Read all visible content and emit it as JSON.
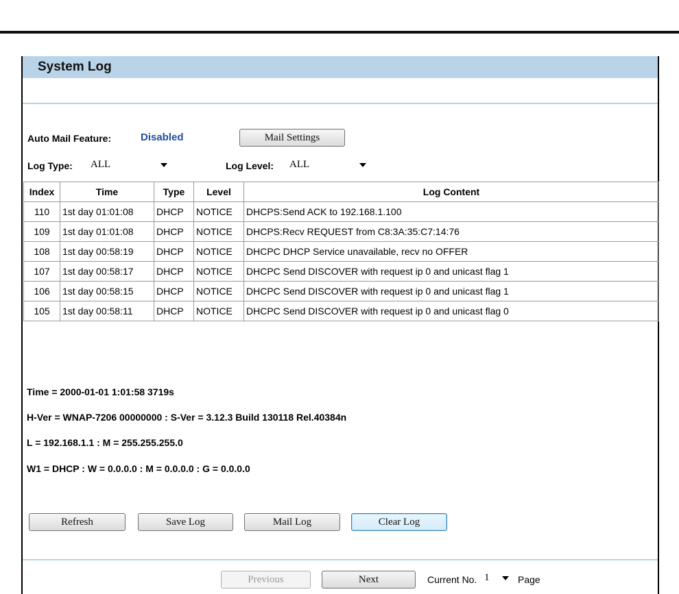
{
  "title": "System Log",
  "mail": {
    "label": "Auto Mail Feature:",
    "status": "Disabled",
    "settings_button": "Mail Settings"
  },
  "filters": {
    "log_type_label": "Log Type:",
    "log_type_value": "ALL",
    "log_level_label": "Log Level:",
    "log_level_value": "ALL"
  },
  "table": {
    "headers": [
      "Index",
      "Time",
      "Type",
      "Level",
      "Log Content"
    ],
    "rows": [
      [
        "110",
        "1st day 01:01:08",
        "DHCP",
        "NOTICE",
        "DHCPS:Send ACK to 192.168.1.100"
      ],
      [
        "109",
        "1st day 01:01:08",
        "DHCP",
        "NOTICE",
        "DHCPS:Recv REQUEST from C8:3A:35:C7:14:76"
      ],
      [
        "108",
        "1st day 00:58:19",
        "DHCP",
        "NOTICE",
        "DHCPC DHCP Service unavailable, recv no OFFER"
      ],
      [
        "107",
        "1st day 00:58:17",
        "DHCP",
        "NOTICE",
        "DHCPC Send DISCOVER with request ip 0 and unicast flag 1"
      ],
      [
        "106",
        "1st day 00:58:15",
        "DHCP",
        "NOTICE",
        "DHCPC Send DISCOVER with request ip 0 and unicast flag 1"
      ],
      [
        "105",
        "1st day 00:58:11",
        "DHCP",
        "NOTICE",
        "DHCPC Send DISCOVER with request ip 0 and unicast flag 0"
      ]
    ]
  },
  "info": {
    "time": "Time = 2000-01-01 1:01:58 3719s",
    "version": "H-Ver = WNAP-7206 00000000 : S-Ver = 3.12.3 Build 130118 Rel.40384n",
    "lan": "L = 192.168.1.1 : M = 255.255.255.0",
    "wan": "W1 = DHCP : W = 0.0.0.0 : M = 0.0.0.0 : G = 0.0.0.0"
  },
  "actions": {
    "refresh": "Refresh",
    "save_log": "Save Log",
    "mail_log": "Mail Log",
    "clear_log": "Clear Log"
  },
  "pagination": {
    "previous": "Previous",
    "next": "Next",
    "current_label": "Current No.",
    "current_value": "1",
    "page_label": "Page"
  },
  "colors": {
    "title_bar": "#b9d4e8",
    "status_disabled": "#1f4e9c"
  }
}
